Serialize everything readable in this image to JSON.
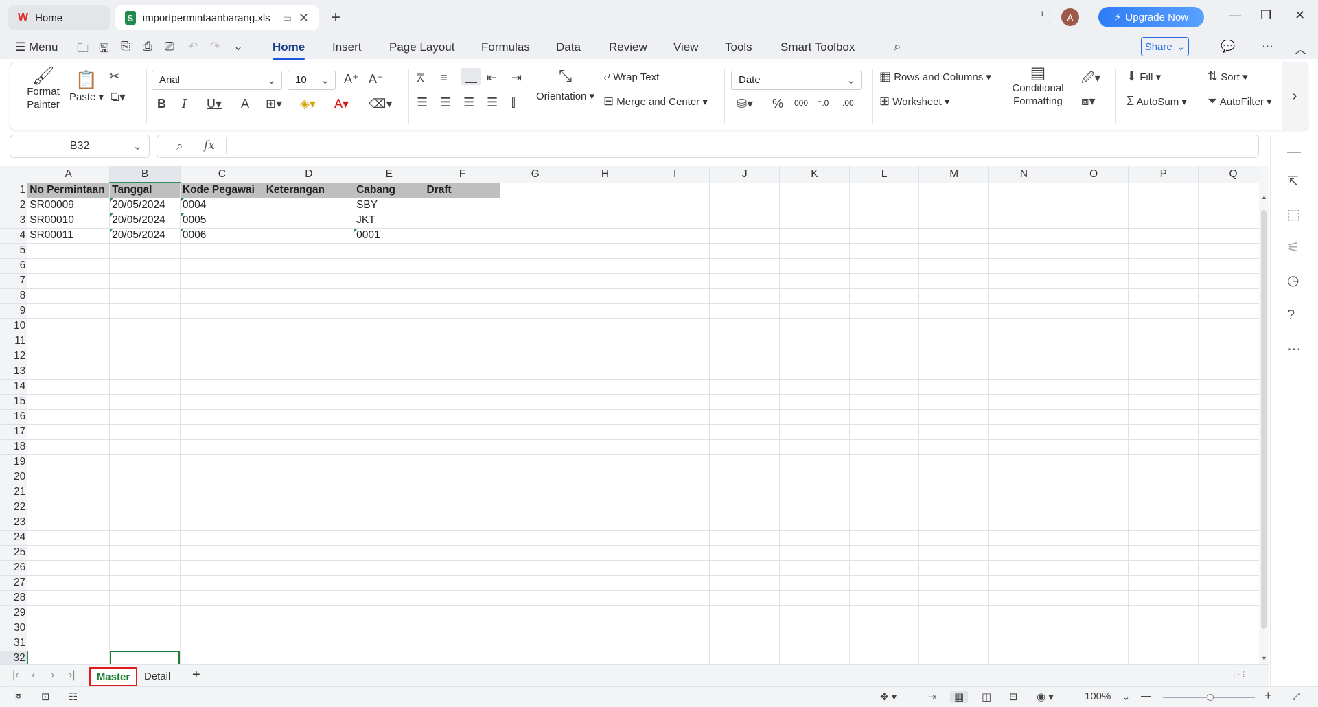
{
  "tabs": {
    "home": "Home",
    "file": "importpermintaanbarang.xls"
  },
  "titlebar": {
    "avatar": "A",
    "upgrade": "Upgrade Now",
    "page_count": "1"
  },
  "menu": {
    "menu_label": "Menu",
    "ribbon_tabs": [
      "Home",
      "Insert",
      "Page Layout",
      "Formulas",
      "Data",
      "Review",
      "View",
      "Tools",
      "Smart Toolbox"
    ],
    "share": "Share"
  },
  "ribbon": {
    "format_painter": "Format Painter",
    "paste": "Paste",
    "font": "Arial",
    "font_size": "10",
    "wrap_text": "Wrap Text",
    "orientation": "Orientation",
    "merge_center": "Merge and Center",
    "number_format": "Date",
    "rows_columns": "Rows and Columns",
    "worksheet": "Worksheet",
    "conditional_formatting": "Conditional Formatting",
    "fill": "Fill",
    "autosum": "AutoSum",
    "sort": "Sort",
    "autofilter": "AutoFilter"
  },
  "formula_bar": {
    "name_box": "B32",
    "fx": "fx",
    "value": ""
  },
  "sheet": {
    "columns": [
      "A",
      "B",
      "C",
      "D",
      "E",
      "F",
      "G",
      "H",
      "I",
      "J",
      "K",
      "L",
      "M",
      "N",
      "O",
      "P",
      "Q"
    ],
    "header_row": [
      "No Permintaan",
      "Tanggal",
      "Kode Pegawai",
      "Keterangan",
      "Cabang",
      "Draft"
    ],
    "rows": [
      [
        "SR00009",
        "20/05/2024",
        "0004",
        "",
        "SBY",
        ""
      ],
      [
        "SR00010",
        "20/05/2024",
        "0005",
        "",
        "JKT",
        ""
      ],
      [
        "SR00011",
        "20/05/2024",
        "0006",
        "",
        "0001",
        ""
      ]
    ],
    "active_cell": "B32",
    "row_count": 32
  },
  "sheet_tabs": {
    "master": "Master",
    "detail": "Detail",
    "add": "+"
  },
  "status": {
    "zoom": "100%"
  }
}
